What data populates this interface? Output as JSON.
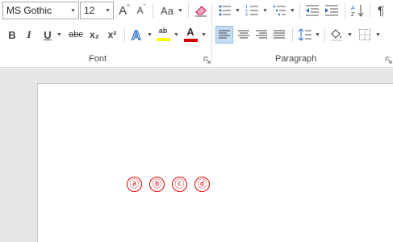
{
  "font_group": {
    "font_name": "MS Gothic",
    "font_size": "12",
    "change_case_label": "Aa",
    "bold_label": "B",
    "italic_label": "I",
    "underline_label": "U",
    "strikethrough_label": "abc",
    "subscript_label": "x₂",
    "superscript_label": "x²",
    "highlight_label": "ab",
    "font_color_label": "A",
    "grow_label": "A",
    "shrink_label": "A",
    "label": "Font",
    "highlight_color": "#ffff00",
    "font_color": "#d40000"
  },
  "paragraph_group": {
    "label": "Paragraph",
    "sort_label": "A Z",
    "show_marks_label": "¶"
  },
  "document": {
    "circled_letters": [
      "ⓐ",
      "ⓑ",
      "ⓒ",
      "ⓓ"
    ],
    "text_color": "#e60000"
  }
}
